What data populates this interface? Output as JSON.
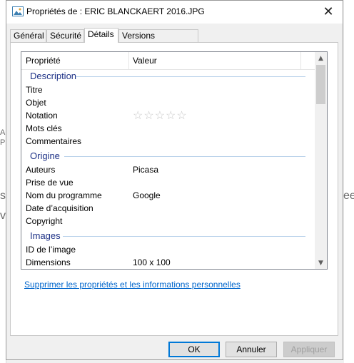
{
  "window": {
    "title": "Propriétés de : ERIC BLANCKAERT 2016.JPG",
    "close_glyph": "✕",
    "icon": "image-file-icon"
  },
  "tabs": [
    {
      "label": "Général"
    },
    {
      "label": "Sécurité"
    },
    {
      "label": "Détails"
    },
    {
      "label": "Versions précédentes"
    }
  ],
  "active_tab": "Détails",
  "table": {
    "col_property": "Propriété",
    "col_value": "Valeur",
    "groups": [
      {
        "name": "Description",
        "rows": [
          {
            "property": "Titre",
            "value": ""
          },
          {
            "property": "Objet",
            "value": ""
          },
          {
            "property": "Notation",
            "value": "",
            "rating": 0,
            "rating_max": 5
          },
          {
            "property": "Mots clés",
            "value": ""
          },
          {
            "property": "Commentaires",
            "value": ""
          }
        ]
      },
      {
        "name": "Origine",
        "rows": [
          {
            "property": "Auteurs",
            "value": "Picasa"
          },
          {
            "property": "Prise de vue",
            "value": ""
          },
          {
            "property": "Nom du programme",
            "value": "Google"
          },
          {
            "property": "Date d’acquisition",
            "value": ""
          },
          {
            "property": "Copyright",
            "value": ""
          }
        ]
      },
      {
        "name": "Images",
        "rows": [
          {
            "property": "ID de l’image",
            "value": ""
          },
          {
            "property": "Dimensions",
            "value": "100 x 100"
          }
        ]
      }
    ]
  },
  "remove_link": "Supprimer les propriétés et les informations personnelles",
  "buttons": {
    "ok": "OK",
    "cancel": "Annuler",
    "apply": "Appliquer"
  },
  "colors": {
    "group_header": "#1e3287",
    "group_line": "#b9d1ea",
    "link": "#0066cc",
    "default_button_border": "#0078d7"
  }
}
